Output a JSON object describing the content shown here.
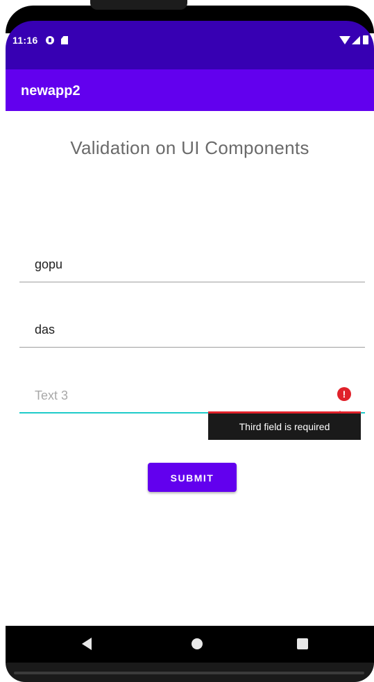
{
  "status_bar": {
    "time": "11:16",
    "icons": [
      "data-saver-icon",
      "sd-card-icon",
      "wifi-icon",
      "signal-icon",
      "battery-icon"
    ]
  },
  "app_bar": {
    "title": "newapp2",
    "color": "#6200EE"
  },
  "heading": "Validation on UI Components",
  "form": {
    "fields": [
      {
        "value": "gopu",
        "placeholder": ""
      },
      {
        "value": "das",
        "placeholder": ""
      },
      {
        "value": "",
        "placeholder": "Text 3",
        "error": "Third field is required"
      }
    ],
    "submit_label": "SUBMIT"
  },
  "colors": {
    "status_bar": "#3700B3",
    "accent": "#6200EE",
    "focus": "#1ecbc9",
    "error": "#e0212a"
  },
  "nav_bar": {
    "icons": [
      "back-icon",
      "home-icon",
      "recents-icon"
    ]
  }
}
